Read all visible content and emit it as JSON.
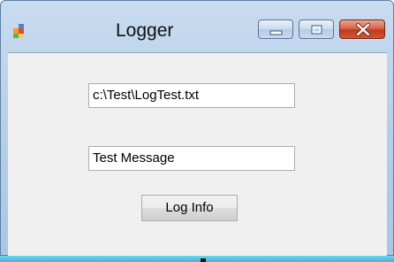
{
  "window": {
    "title": "Logger",
    "icons": {
      "app": "windows-form-icon",
      "minimize": "minimize-icon",
      "maximize": "maximize-icon",
      "close": "close-icon"
    }
  },
  "form": {
    "file_path_value": "c:\\Test\\LogTest.txt",
    "message_value": "Test Message",
    "log_button_label": "Log Info"
  },
  "colors": {
    "titlebar": "#b9d1ea",
    "client_background": "#f0f0f0",
    "close_button": "#c0391e",
    "taskbar_accent": "#3fb6d8"
  }
}
